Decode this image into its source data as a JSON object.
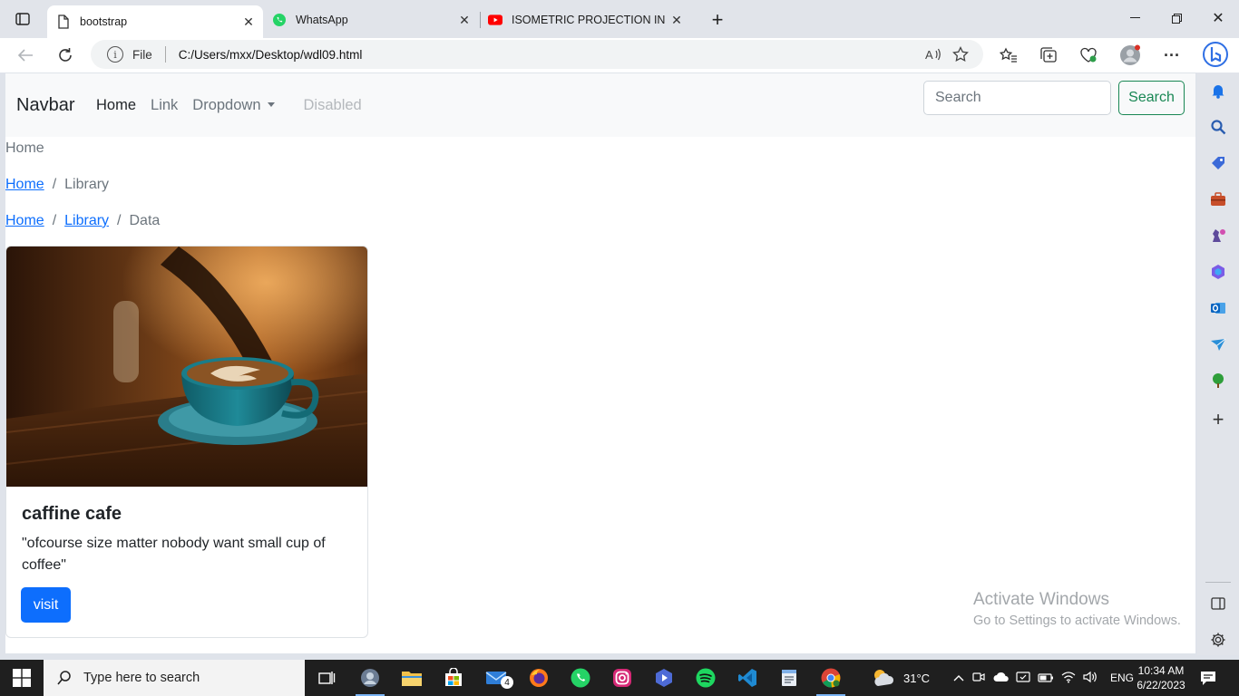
{
  "browser": {
    "tabs": [
      {
        "title": "bootstrap",
        "active": true,
        "favicon": "page-icon"
      },
      {
        "title": "WhatsApp",
        "active": false,
        "favicon": "whatsapp-icon"
      },
      {
        "title": "ISOMETRIC PROJECTION IN ENG",
        "active": false,
        "favicon": "youtube-icon"
      }
    ],
    "address": {
      "scheme": "File",
      "url": "C:/Users/mxx/Desktop/wdl09.html"
    }
  },
  "page": {
    "navbar": {
      "brand": "Navbar",
      "links": {
        "home": "Home",
        "link": "Link",
        "dropdown": "Dropdown",
        "disabled": "Disabled"
      },
      "search_placeholder": "Search",
      "search_button": "Search"
    },
    "breadcrumbs": {
      "first": {
        "current": "Home"
      },
      "second": {
        "home": "Home",
        "current": "Library"
      },
      "third": {
        "home": "Home",
        "library": "Library",
        "current": "Data"
      }
    },
    "card": {
      "title": "caffine cafe",
      "text": "\"ofcourse size matter nobody want small cup of coffee\"",
      "button": "visit"
    },
    "watermark": {
      "line1": "Activate Windows",
      "line2": "Go to Settings to activate Windows."
    }
  },
  "taskbar": {
    "search_placeholder": "Type here to search",
    "mail_badge": "4",
    "weather": "31°C",
    "language": "ENG",
    "time": "10:34 AM",
    "date": "6/22/2023"
  },
  "colors": {
    "primary": "#0d6efd",
    "success": "#198754",
    "navbar_bg": "#f8f9fa",
    "taskbar_bg": "#1f1f1f"
  }
}
